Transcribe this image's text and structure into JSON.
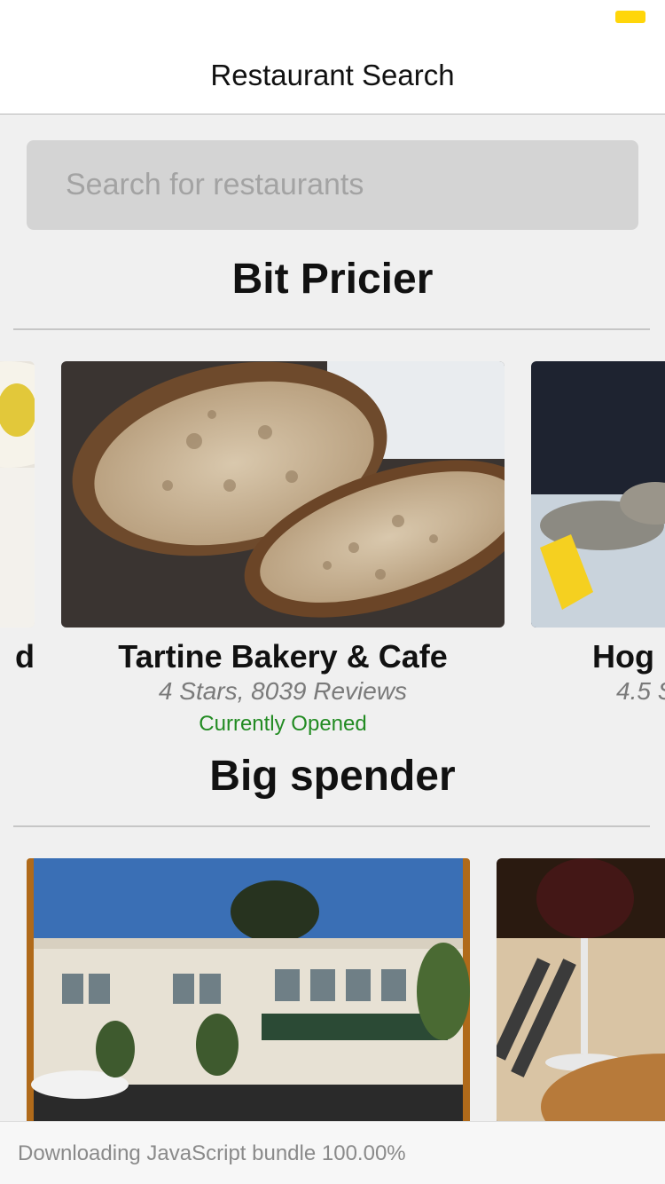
{
  "nav": {
    "title": "Restaurant Search"
  },
  "search": {
    "placeholder": "Search for restaurants"
  },
  "sections": [
    {
      "title": "Bit Pricier",
      "cards": [
        {
          "name": "d",
          "rating": "",
          "status": "",
          "photo": "food-photo-plate"
        },
        {
          "name": "Tartine Bakery & Cafe",
          "rating": "4 Stars, 8039 Reviews",
          "status": "Currently Opened",
          "photo": "bread-photo"
        },
        {
          "name": "Hog I",
          "rating": "4.5 S",
          "status": "",
          "photo": "oysters-photo"
        }
      ]
    },
    {
      "title": "Big spender",
      "cards": [
        {
          "name": "",
          "rating": "",
          "status": "",
          "photo": "storefront-photo"
        },
        {
          "name": "",
          "rating": "",
          "status": "",
          "photo": "wine-dinner-photo"
        }
      ]
    }
  ],
  "footer": {
    "text": "Downloading JavaScript bundle 100.00%"
  },
  "colors": {
    "open_status": "#228b22",
    "battery": "#ffd60a"
  }
}
